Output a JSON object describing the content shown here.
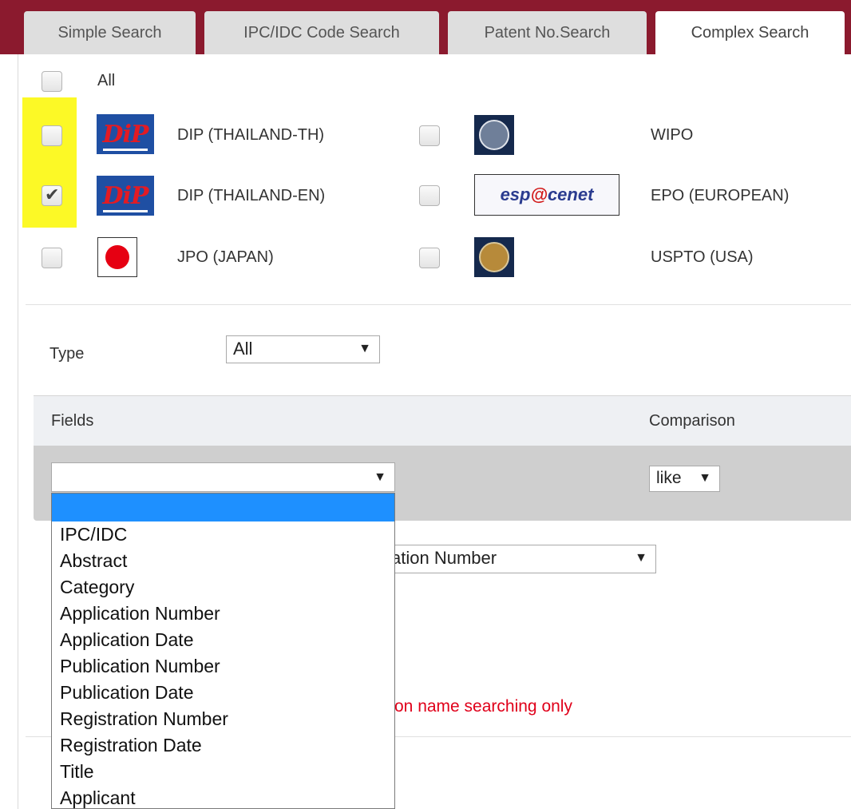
{
  "tabs": [
    {
      "label": "Simple Search"
    },
    {
      "label": "IPC/IDC Code Search"
    },
    {
      "label": "Patent No.Search"
    },
    {
      "label": "Complex Search"
    }
  ],
  "active_tab": "Complex Search",
  "databases": {
    "all_label": "All",
    "items": [
      {
        "label": "DIP (THAILAND-TH)",
        "checked": false,
        "logo": "dip-logo"
      },
      {
        "label": "DIP (THAILAND-EN)",
        "checked": true,
        "logo": "dip-logo"
      },
      {
        "label": "JPO (JAPAN)",
        "checked": false,
        "logo": "jpo-logo"
      },
      {
        "label": "WIPO",
        "checked": false,
        "logo": "wipo-logo"
      },
      {
        "label": "EPO (EUROPEAN)",
        "checked": false,
        "logo": "espacenet-logo"
      },
      {
        "label": "USPTO (USA)",
        "checked": false,
        "logo": "uspto-logo"
      }
    ],
    "espacenet": {
      "pre": "esp",
      "at": "@",
      "post": "cenet"
    },
    "highlight_color": "#fbf800"
  },
  "type_row": {
    "label": "Type",
    "value": "All"
  },
  "fields_table": {
    "fields_header": "Fields",
    "comparison_header": "Comparison",
    "field_value": "",
    "comparison_value": "like"
  },
  "field_options": [
    "",
    "IPC/IDC",
    "Abstract",
    "Category",
    "Application Number",
    "Application Date",
    "Publication Number",
    "Publication Date",
    "Registration Number",
    "Registration Date",
    "Title",
    "Applicant"
  ],
  "background_select_value": "cation Number",
  "partial_note": "on name searching only",
  "colors": {
    "brand": "#8b1a2e",
    "selected_option": "#1e90ff",
    "note": "#e0001a"
  }
}
